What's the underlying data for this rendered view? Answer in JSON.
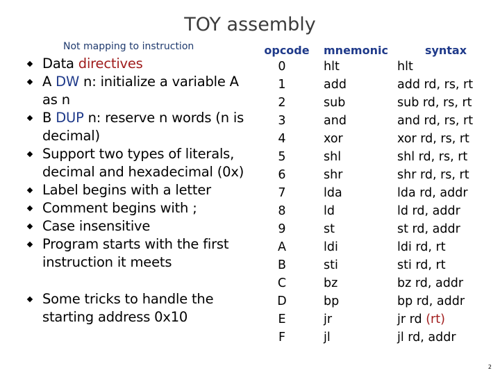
{
  "title": "TOY assembly",
  "subnote": "Not mapping to instruction",
  "colors": {
    "title": "#3c3c3c",
    "subnote": "#1f3a6e",
    "highlight_red": "#a01c1c",
    "highlight_blue": "#1f3a8a",
    "table_header": "#1f3a8a"
  },
  "bullets": [
    {
      "parts": [
        {
          "text": "Data ",
          "style": "normal"
        },
        {
          "text": "directives",
          "style": "red"
        }
      ]
    },
    {
      "parts": [
        {
          "text": "A ",
          "style": "normal"
        },
        {
          "text": "DW",
          "style": "blue"
        },
        {
          "text": " n: initialize a variable A as n",
          "style": "normal"
        }
      ]
    },
    {
      "parts": [
        {
          "text": "B ",
          "style": "normal"
        },
        {
          "text": "DUP",
          "style": "blue"
        },
        {
          "text": " n: reserve n words (n is decimal)",
          "style": "normal"
        }
      ]
    },
    {
      "parts": [
        {
          "text": "Support two types of literals, decimal and hexadecimal (0x)",
          "style": "normal"
        }
      ]
    },
    {
      "parts": [
        {
          "text": "Label begins with a letter",
          "style": "normal"
        }
      ]
    },
    {
      "parts": [
        {
          "text": "Comment begins with ;",
          "style": "normal"
        }
      ]
    },
    {
      "parts": [
        {
          "text": "Case insensitive",
          "style": "normal"
        }
      ]
    },
    {
      "parts": [
        {
          "text": "Program starts with the first instruction it meets",
          "style": "normal"
        }
      ]
    },
    {
      "parts": [
        {
          "text": "Some tricks to handle the starting address 0x10",
          "style": "normal"
        }
      ]
    }
  ],
  "table": {
    "headers": {
      "opcode": "opcode",
      "mnemonic": "mnemonic",
      "syntax": "syntax"
    },
    "rows": [
      {
        "opcode": "0",
        "mnemonic": "hlt",
        "syntax": "hlt",
        "syntax_extra": ""
      },
      {
        "opcode": "1",
        "mnemonic": "add",
        "syntax": "add rd, rs, rt",
        "syntax_extra": ""
      },
      {
        "opcode": "2",
        "mnemonic": "sub",
        "syntax": "sub rd, rs, rt",
        "syntax_extra": ""
      },
      {
        "opcode": "3",
        "mnemonic": "and",
        "syntax": "and rd, rs, rt",
        "syntax_extra": ""
      },
      {
        "opcode": "4",
        "mnemonic": "xor",
        "syntax": "xor rd, rs, rt",
        "syntax_extra": ""
      },
      {
        "opcode": "5",
        "mnemonic": "shl",
        "syntax": "shl rd, rs, rt",
        "syntax_extra": ""
      },
      {
        "opcode": "6",
        "mnemonic": "shr",
        "syntax": "shr rd, rs, rt",
        "syntax_extra": ""
      },
      {
        "opcode": "7",
        "mnemonic": "lda",
        "syntax": "lda rd, addr",
        "syntax_extra": ""
      },
      {
        "opcode": "8",
        "mnemonic": "ld",
        "syntax": "ld rd, addr",
        "syntax_extra": ""
      },
      {
        "opcode": "9",
        "mnemonic": "st",
        "syntax": "st rd, addr",
        "syntax_extra": ""
      },
      {
        "opcode": "A",
        "mnemonic": "ldi",
        "syntax": "ldi rd, rt",
        "syntax_extra": ""
      },
      {
        "opcode": "B",
        "mnemonic": "sti",
        "syntax": "sti rd, rt",
        "syntax_extra": ""
      },
      {
        "opcode": "C",
        "mnemonic": "bz",
        "syntax": "bz rd, addr",
        "syntax_extra": ""
      },
      {
        "opcode": "D",
        "mnemonic": "bp",
        "syntax": "bp rd, addr",
        "syntax_extra": ""
      },
      {
        "opcode": "E",
        "mnemonic": "jr",
        "syntax": "jr rd ",
        "syntax_extra": "(rt)"
      },
      {
        "opcode": "F",
        "mnemonic": "jl",
        "syntax": "jl rd, addr",
        "syntax_extra": ""
      }
    ]
  },
  "page_number": "2"
}
